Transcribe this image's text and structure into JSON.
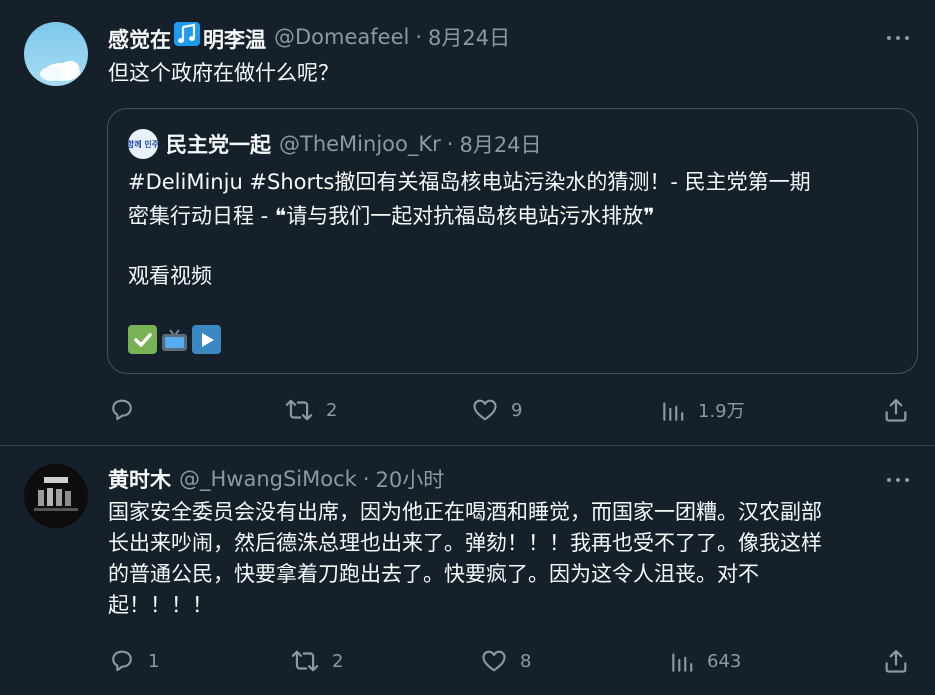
{
  "tweets": [
    {
      "display_name_prefix": "感觉在",
      "display_name_suffix": "明李温",
      "name_icon": "musical-note-icon",
      "handle": "@Domeafeel",
      "separator": "·",
      "time": "8月24日",
      "text": "但这个政府在做什么呢？",
      "quote": {
        "display_name": "民主党一起",
        "avatar_text": "다함께 민주당",
        "handle": "@TheMinjoo_Kr",
        "separator": "·",
        "time": "8月24日",
        "line1": "#DeliMinju #Shorts撤回有关福岛核电站污染水的猜测！- 民主党第一期",
        "line2": "密集行动日程 - ❝请与我们一起对抗福岛核电站污水排放❞",
        "line3": "观看视频",
        "emojis": [
          "check-mark-icon",
          "television-icon",
          "play-button-icon"
        ]
      },
      "actions": {
        "reply": "",
        "retweet": "2",
        "like": "9",
        "views": "1.9万"
      }
    },
    {
      "display_name": "黄时木",
      "handle": "@_HwangSiMock",
      "separator": "·",
      "time": "20小时",
      "lines": [
        "国家安全委员会没有出席，因为他正在喝酒和睡觉，而国家一团糟。汉农副部",
        "长出来吵闹，然后德洙总理也出来了。弹劾！！！我再也受不了了。像我这样",
        "的普通公民，快要拿着刀跑出去了。快要疯了。因为这令人沮丧。对不",
        "起！！！！"
      ],
      "actions": {
        "reply": "1",
        "retweet": "2",
        "like": "8",
        "views": "643"
      }
    }
  ],
  "colors": {
    "background": "#15202b",
    "text": "#f7f9f9",
    "secondary": "#8b98a5",
    "border": "#38444d",
    "note_icon": "#1d9bf0"
  }
}
